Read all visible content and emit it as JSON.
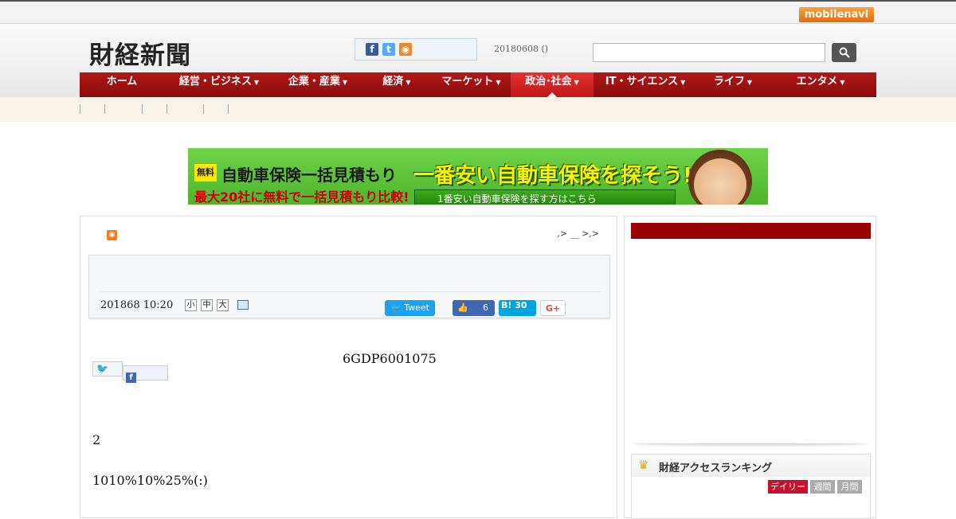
{
  "top": {
    "mobile_navi": "mobilenavi"
  },
  "header": {
    "logo": "財経新聞",
    "date": "20180608 ()",
    "search": {
      "placeholder": "",
      "button_icon": "search-icon"
    },
    "social": [
      "facebook-icon",
      "twitter-icon",
      "rss-icon"
    ]
  },
  "nav": {
    "items": [
      {
        "label": "ホーム",
        "caret": ""
      },
      {
        "label": "経営・ビジネス",
        "caret": "▼"
      },
      {
        "label": "企業・産業",
        "caret": "▼"
      },
      {
        "label": "経済",
        "caret": "▼"
      },
      {
        "label": "マーケット",
        "caret": "▼"
      },
      {
        "label": "政治･社会",
        "caret": "▼"
      },
      {
        "label": "IT・サイエンス",
        "caret": "▼"
      },
      {
        "label": "ライフ",
        "caret": "▼"
      },
      {
        "label": "エンタメ",
        "caret": "▼"
      }
    ],
    "active_index": 5,
    "active_color": "#d42020"
  },
  "ad": {
    "free": "無料",
    "line1": "自動車保険一括見積もり",
    "line2": "最大20社に無料で一括見積もり比較!",
    "headline": "一番安い自動車保険を探そう!",
    "button": "1番安い自動車保険を探す方はこちら"
  },
  "article": {
    "breadcrumb": {
      "part1": ",>",
      "mark": "__",
      "part2": ">,>"
    },
    "date": "201868 10:20",
    "sizes": [
      "小",
      "中",
      "大"
    ],
    "share": {
      "tweet": "Tweet",
      "like_count": "6",
      "hatena": "B! 30",
      "gplus": "G+"
    },
    "lines": [
      "6GDP6001075",
      "2",
      "1010%10%25%(:)"
    ]
  },
  "sidebar": {
    "ranking_title": "財経アクセスランキング",
    "tabs": [
      "デイリー",
      "週間",
      "月間"
    ]
  }
}
